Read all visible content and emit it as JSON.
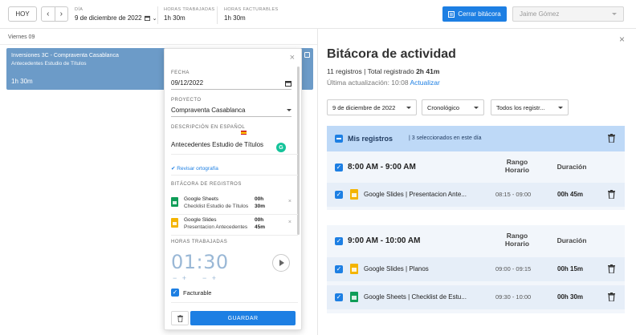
{
  "colors": {
    "accent": "#1d7fe3",
    "event_bg": "#6c9bc8",
    "selection_bar": "#bed9f7",
    "row_bg": "#e6eef8",
    "slides_yellow": "#f4b400",
    "sheets_green": "#0f9d58"
  },
  "topbar": {
    "today_label": "HOY",
    "prev_icon": "chevron-left-icon",
    "next_icon": "chevron-right-icon",
    "day_label": "DÍA",
    "day_value": "9 de diciembre de 2022",
    "worked_label": "HORAS TRABAJADAS",
    "worked_value": "1h 30m",
    "billable_label": "HORAS FACTURABLES",
    "billable_value": "1h 30m",
    "close_log_label": "Cerrar bitácora",
    "user_value": "Jaime Gómez"
  },
  "calendar": {
    "day_heading": "Viernes 09",
    "event": {
      "title": "Inversiones 3C - Compraventa Casablanca",
      "description": "Antecedentes Estudio de Títulos",
      "hours": "1h 30m"
    }
  },
  "editor": {
    "date_label": "FECHA",
    "date_value": "09/12/2022",
    "project_label": "PROYECTO",
    "project_value": "Compraventa Casablanca",
    "description_label": "DESCRIPCIÓN EN ESPAÑOL",
    "description_value": "Antecedentes Estudio de Títulos",
    "spellcheck_label": "Revisar ortografía",
    "log_label": "BITÁCORA DE REGISTROS",
    "log_entries": [
      {
        "app": "Google Sheets",
        "detail": "Checklist Estudio de Títulos",
        "hours": "00h",
        "minutes": "30m"
      },
      {
        "app": "Google Slides",
        "detail": "Presentacion Antecedentes",
        "hours": "00h",
        "minutes": "45m"
      }
    ],
    "hours_worked_label": "HORAS TRABAJADAS",
    "timer_value": "01:30",
    "billable_label": "Facturable",
    "save_label": "GUARDAR"
  },
  "panel": {
    "title": "Bitácora de actividad",
    "records_count": "11 registros",
    "total_label": "Total registrado",
    "total_value": "2h 41m",
    "last_update": "Última actualización: 10:08",
    "refresh_label": "Actualizar",
    "filter_date": "9 de diciembre de 2022",
    "filter_order": "Cronológico",
    "filter_records": "Todos los registr...",
    "mine_title": "Mis registros",
    "mine_count": "3 seleccionados en este día",
    "col_range": "Rango Horario",
    "col_duration": "Duración",
    "groups": [
      {
        "range": "8:00 AM - 9:00 AM",
        "entries": [
          {
            "name": "Google Slides | Presentacion Ante...",
            "range": "08:15 - 09:00",
            "duration": "00h 45m"
          }
        ]
      },
      {
        "range": "9:00 AM - 10:00 AM",
        "entries": [
          {
            "name": "Google Slides | Planos",
            "range": "09:00 - 09:15",
            "duration": "00h 15m"
          },
          {
            "name": "Google Sheets | Checklist de Estu...",
            "range": "09:30 - 10:00",
            "duration": "00h 30m"
          }
        ]
      }
    ]
  }
}
